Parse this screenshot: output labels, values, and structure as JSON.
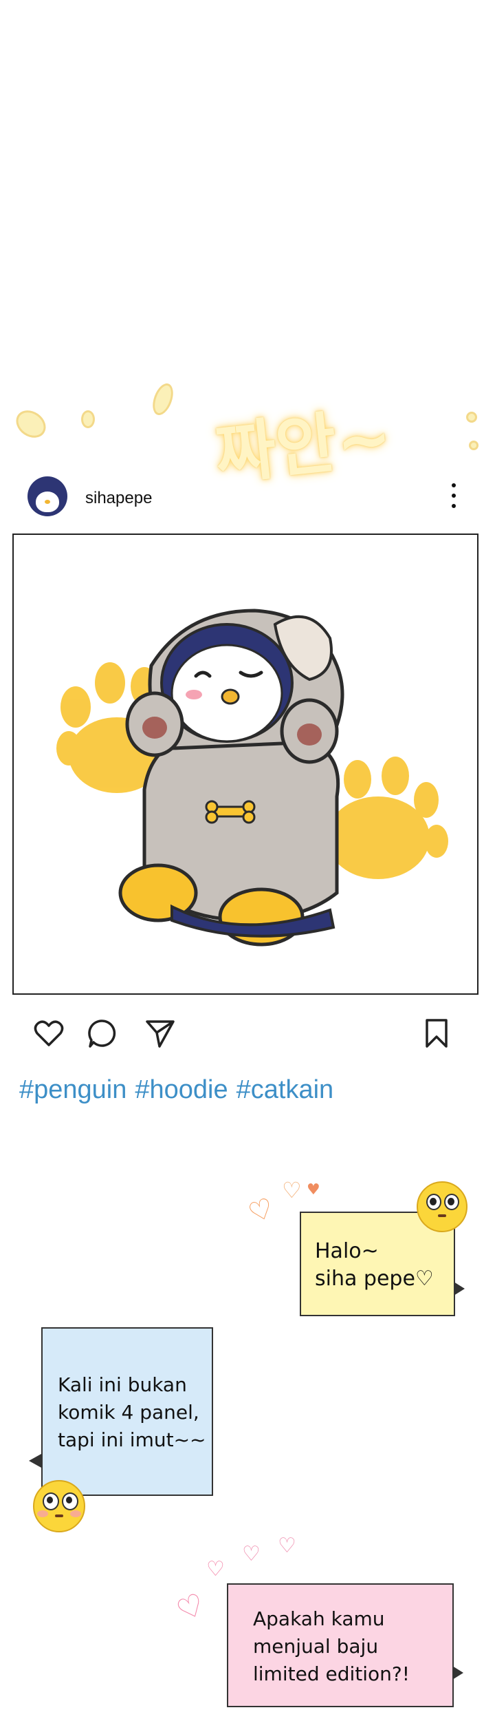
{
  "title_effect": {
    "text": "짜안~"
  },
  "post": {
    "username": "sihapepe",
    "hashtags": [
      "#penguin",
      "#hoodie",
      "#catkain"
    ]
  },
  "icons": {
    "avatar": "penguin-avatar",
    "more": "more-vertical-icon",
    "like": "heart-icon",
    "comment": "comment-icon",
    "share": "send-icon",
    "save": "bookmark-icon"
  },
  "dialogue": {
    "bubble1": "Halo~\nsiha pepe♡",
    "bubble2": "Kali ini bukan\nkomik 4 panel,\ntapi ini imut~~",
    "bubble3": "Apakah kamu\nmenjual baju\nlimited edition?!"
  },
  "colors": {
    "hashtag": "#3d8fc7",
    "bubble1_bg": "#fef6b4",
    "bubble2_bg": "#d6eaf9",
    "bubble3_bg": "#fcd5e3",
    "penguin_navy": "#2d3574",
    "paw_yellow": "#f9c532"
  }
}
